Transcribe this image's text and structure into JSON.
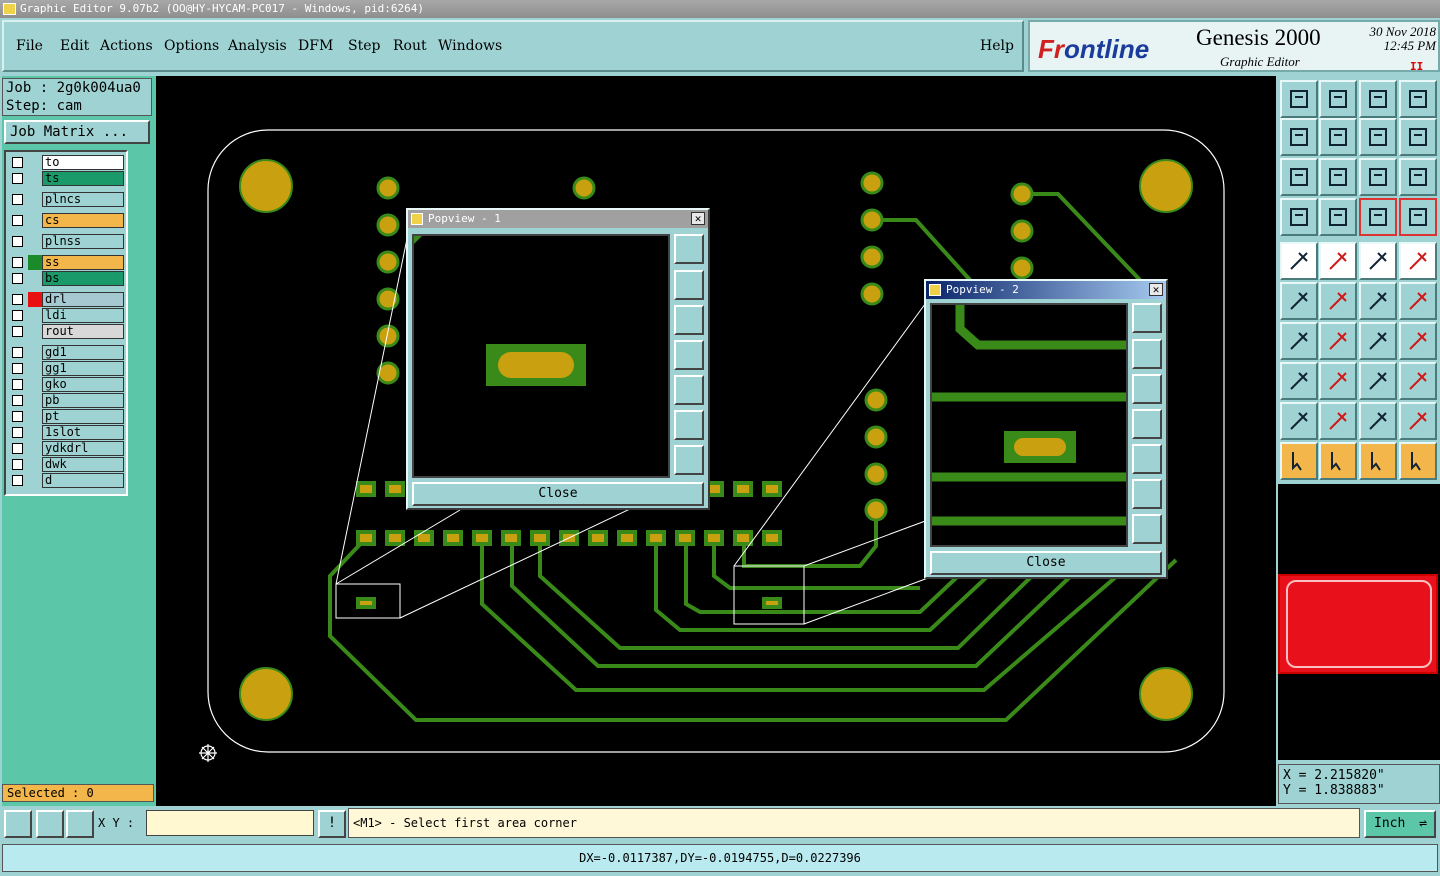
{
  "window": {
    "title": "Graphic Editor 9.07b2 (OO@HY-HYCAM-PC017 - Windows, pid:6264)"
  },
  "menu": {
    "file": "File",
    "edit": "Edit",
    "actions": "Actions",
    "options": "Options",
    "analysis": "Analysis",
    "dfm": "DFM",
    "step": "Step",
    "rout": "Rout",
    "windows": "Windows",
    "help": "Help"
  },
  "brand": {
    "logo_a": "Fr",
    "logo_b": "ontline",
    "product": "Genesis 2000",
    "subtitle": "Graphic Editor",
    "date": "30 Nov 2018",
    "time": "12:45 PM",
    "pause": "II"
  },
  "job": {
    "job_line": "Job : 2g0k004ua0",
    "step_line": "Step: cam",
    "matrix_button": "Job Matrix ..."
  },
  "layers": [
    {
      "name": "to",
      "color": "#ffffff",
      "swatch": "#9fd3d3"
    },
    {
      "name": "ts",
      "color": "#1a9a6a",
      "swatch": "#9fd3d3"
    },
    {
      "name": "plncs",
      "color": "#9fd3d3",
      "swatch": "#9fd3d3"
    },
    {
      "name": "cs",
      "color": "#f3b64a",
      "swatch": "#9fd3d3"
    },
    {
      "name": "plnss",
      "color": "#9fd3d3",
      "swatch": "#9fd3d3"
    },
    {
      "name": "ss",
      "color": "#f3b64a",
      "swatch": "#1a8a2a"
    },
    {
      "name": "bs",
      "color": "#1a9a6a",
      "swatch": "#9fd3d3"
    },
    {
      "name": "drl",
      "color": "#a6c8d0",
      "swatch": "#e81010"
    },
    {
      "name": "ldi",
      "color": "#9fd3d3",
      "swatch": "#9fd3d3"
    },
    {
      "name": "rout",
      "color": "#d8d8d8",
      "swatch": "#9fd3d3"
    },
    {
      "name": "gd1",
      "color": "#9fd3d3",
      "swatch": "#9fd3d3"
    },
    {
      "name": "gg1",
      "color": "#9fd3d3",
      "swatch": "#9fd3d3"
    },
    {
      "name": "gko",
      "color": "#9fd3d3",
      "swatch": "#9fd3d3"
    },
    {
      "name": "pb",
      "color": "#9fd3d3",
      "swatch": "#9fd3d3"
    },
    {
      "name": "pt",
      "color": "#9fd3d3",
      "swatch": "#9fd3d3"
    },
    {
      "name": "1slot",
      "color": "#9fd3d3",
      "swatch": "#9fd3d3"
    },
    {
      "name": "ydkdrl",
      "color": "#9fd3d3",
      "swatch": "#9fd3d3"
    },
    {
      "name": "dwk",
      "color": "#9fd3d3",
      "swatch": "#9fd3d3"
    },
    {
      "name": "d",
      "color": "#9fd3d3",
      "swatch": "#9fd3d3"
    }
  ],
  "selected": "Selected : 0",
  "popview1": {
    "title": "Popview - 1",
    "close": "Close"
  },
  "popview2": {
    "title": "Popview - 2",
    "close": "Close"
  },
  "coords": {
    "x": "X = 2.215820\"",
    "y": "Y = 1.838883\""
  },
  "command": {
    "xy_label": "X Y :",
    "xy_value": "",
    "bang": "!",
    "prompt": "<M1> - Select first area corner",
    "unit": "Inch"
  },
  "status": "DX=-0.0117387,DY=-0.0194755,D=0.0227396",
  "colors": {
    "board": "#000000",
    "trace": "#3a8a1a",
    "pad": "#c8a010",
    "panel": "#9fd3d3",
    "matrix": "#5cc7a8",
    "highlight": "#e8101a"
  }
}
